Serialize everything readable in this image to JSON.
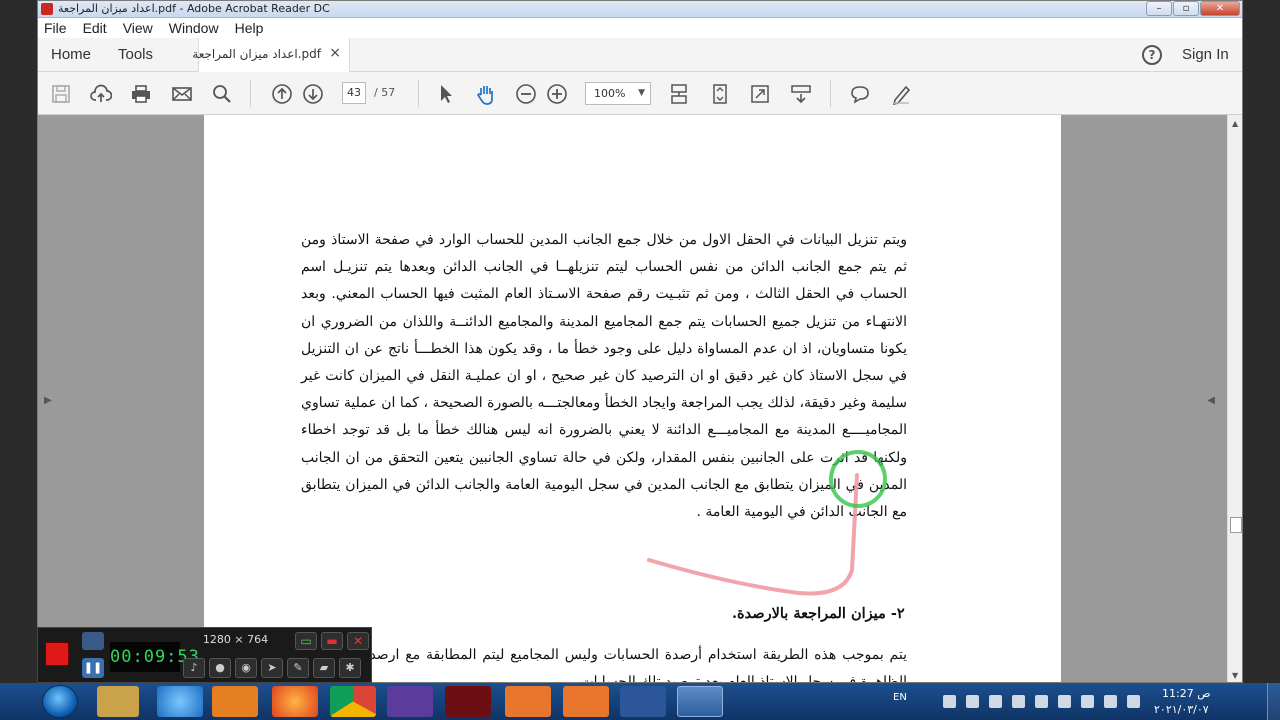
{
  "window": {
    "title": "اعداد ميزان المراجعة.pdf - Adobe Acrobat Reader DC",
    "controls": [
      "–",
      "▫",
      "✕"
    ]
  },
  "menu": [
    "File",
    "Edit",
    "View",
    "Window",
    "Help"
  ],
  "tabs": {
    "home": "Home",
    "tools": "Tools",
    "document": "اعداد ميزان المراجعة.pdf",
    "close": "×",
    "signin": "Sign In",
    "help": "?"
  },
  "toolbar": {
    "page_current": "43",
    "page_total": "/ 57",
    "zoom": "100%",
    "zoom_caret": "▼"
  },
  "document": {
    "paragraph1": "ويتم تنزيل البيانات في الحقل الاول من خلال جمع الجانب المدين للحساب الوارد في صفحة الاستاذ ومن ثم يتم جمع الجانب الدائن من نفس الحساب ليتم تنزيلهــا في الجانب الدائن وبعدها يتم تنزيـل اسم الحساب في الحقل الثالث ، ومن ثم تثبـيت رقم صفحة الاسـتاذ العام المثبت فيها الحساب المعني. وبعد الانتهـاء من تنزيل جميع الحسابات يتم جمع المجاميع المدينة والمجاميع الدائنــة واللذان من الضروري ان يكونا متساويان، اذ ان عدم المساواة دليل على وجود خطأ ما ، وقد يكون هذا الخطـــأ ناتج عن ان التنزيل في سجل الاستاذ كان غير دقيق او ان الترصيد كان غير صحيح ، او ان عمليـة النقل في الميزان كانت غير سليمة وغير دقيقة، لذلك يجب المراجعة وايجاد الخطأ ومعالجتـــه بالصورة الصحيحة ، كما ان عملية تساوي المجاميــــع المدينة مع المجاميـــع الدائنة لا يعني بالضرورة انه ليس هنالك خطأ ما بل قد توجد اخطاء ولكنها قد اثرت على الجانبين بنفس المقدار، ولكن في حالة تساوي الجانبين يتعين التحقق من ان الجانب المدين في الميزان يتطابق مع الجانب المدين في سجل اليومية العامة والجانب الدائن في الميزان يتطابق مع الجانب الدائن في اليومية العامة .",
    "heading": "٢- ميزان المراجعة بالارصدة.",
    "paragraph2": "يتم بموجب هذه الطريقة استخدام أرصدة الحسابات وليس المجاميع ليتم المطابقة مع ارصدة الحسابات الظاهرة في سجل الاستاذ العام بعد ترصيد تلك الحسابات"
  },
  "recorder": {
    "timer": "00:09:53",
    "resolution": "1280 × 764",
    "close": "✕"
  },
  "taskbar": {
    "language": "EN",
    "time": "ص 11:27",
    "date": "٢٠٢١/٠٣/٠٧"
  },
  "colors": {
    "accent_pdf": "#c8281e",
    "recorder_timer": "#31d85b",
    "cursor_ring": "#35c44a",
    "taskbar": "#1d4f8f"
  }
}
